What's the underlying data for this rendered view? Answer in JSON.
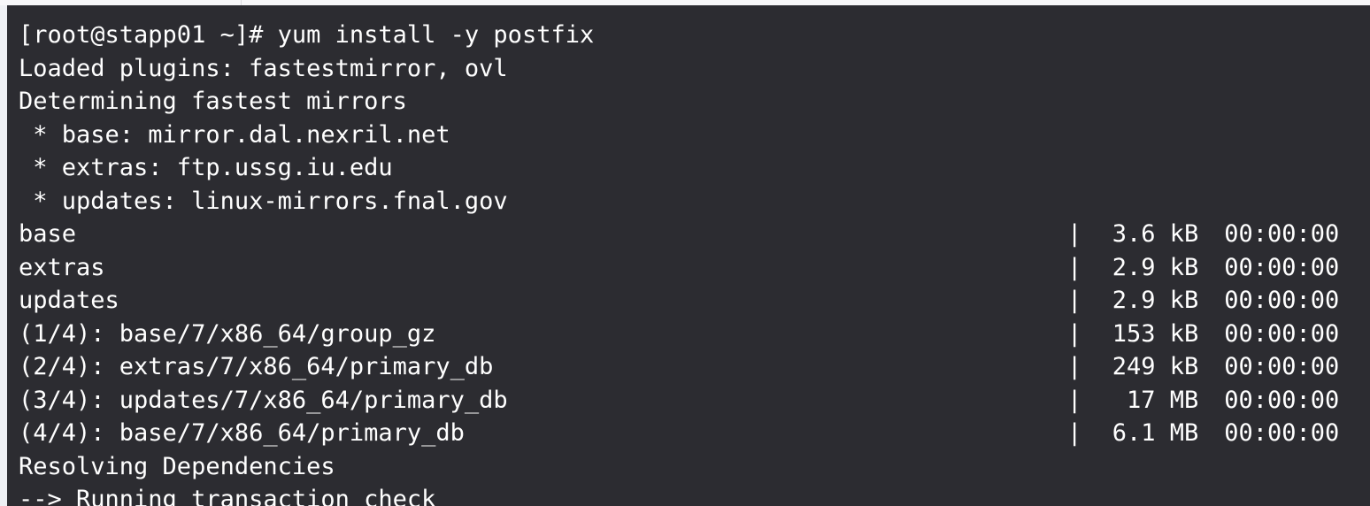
{
  "terminal": {
    "lines": [
      {
        "text": "[root@stapp01 ~]# yum install -y postfix"
      },
      {
        "text": "Loaded plugins: fastestmirror, ovl"
      },
      {
        "text": "Determining fastest mirrors"
      },
      {
        "text": " * base: mirror.dal.nexril.net"
      },
      {
        "text": " * extras: ftp.ussg.iu.edu"
      },
      {
        "text": " * updates: linux-mirrors.fnal.gov"
      },
      {
        "text": "base",
        "bar": "|",
        "size": "3.6 kB",
        "time": "00:00:00"
      },
      {
        "text": "extras",
        "bar": "|",
        "size": "2.9 kB",
        "time": "00:00:00"
      },
      {
        "text": "updates",
        "bar": "|",
        "size": "2.9 kB",
        "time": "00:00:00"
      },
      {
        "text": "(1/4): base/7/x86_64/group_gz",
        "bar": "|",
        "size": "153 kB",
        "time": "00:00:00"
      },
      {
        "text": "(2/4): extras/7/x86_64/primary_db",
        "bar": "|",
        "size": "249 kB",
        "time": "00:00:00"
      },
      {
        "text": "(3/4): updates/7/x86_64/primary_db",
        "bar": "|",
        "size": "17 MB",
        "time": "00:00:00"
      },
      {
        "text": "(4/4): base/7/x86_64/primary_db",
        "bar": "|",
        "size": "6.1 MB",
        "time": "00:00:00"
      },
      {
        "text": "Resolving Dependencies"
      },
      {
        "text": "--> Running transaction check"
      }
    ]
  },
  "colors": {
    "terminal_background": "#2c2c31",
    "terminal_text": "#ffffff"
  }
}
